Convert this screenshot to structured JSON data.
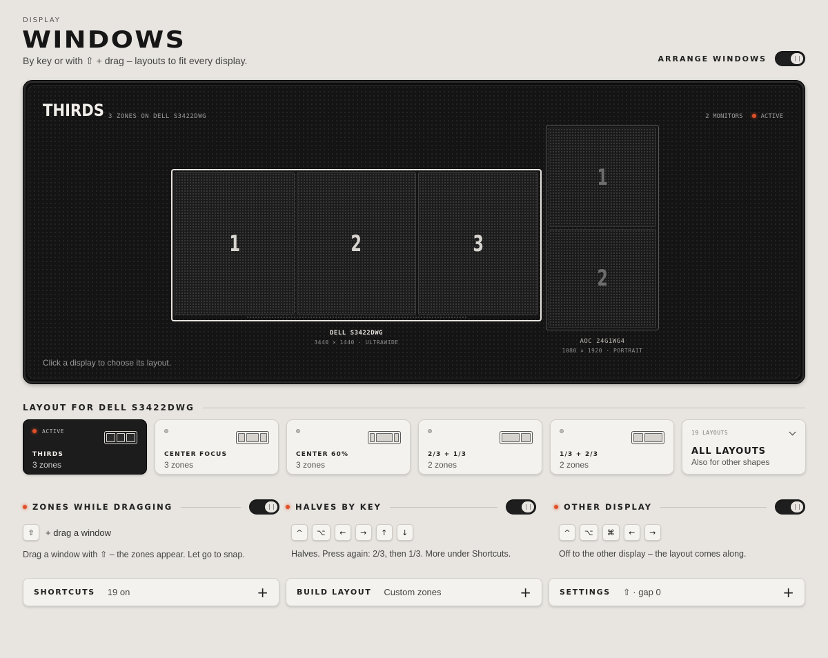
{
  "header": {
    "eyebrow": "DISPLAY",
    "title": "WINDOWS",
    "subtitle": "By key or with ⇧ + drag – layouts to fit every display.",
    "arrange_label": "ARRANGE WINDOWS",
    "arrange_on": true
  },
  "stage": {
    "title": "THIRDS",
    "subtitle": "3 ZONES ON DELL S3422DWG",
    "monitors_count": "2 MONITORS",
    "status": "ACTIVE",
    "hint": "Click a display to choose its layout.",
    "primary": {
      "name": "DELL S3422DWG",
      "spec": "3440 × 1440 · ULTRAWIDE",
      "zones": [
        "1",
        "2",
        "3"
      ]
    },
    "secondary": {
      "name": "AOC 24G1WG4",
      "spec": "1080 × 1920 · PORTRAIT",
      "zones": [
        "1",
        "2"
      ]
    }
  },
  "layouts": {
    "heading": "LAYOUT FOR DELL S3422DWG",
    "active_tag": "ACTIVE",
    "items": [
      {
        "name": "THIRDS",
        "zones": "3 zones"
      },
      {
        "name": "CENTER FOCUS",
        "zones": "3 zones"
      },
      {
        "name": "CENTER 60%",
        "zones": "3 zones"
      },
      {
        "name": "2/3 + 1/3",
        "zones": "2 zones"
      },
      {
        "name": "1/3 + 2/3",
        "zones": "2 zones"
      }
    ],
    "all": {
      "count": "19 LAYOUTS",
      "title": "ALL LAYOUTS",
      "desc": "Also for other shapes"
    }
  },
  "features": [
    {
      "title": "ZONES WHILE DRAGGING",
      "enabled": true,
      "keys": [
        "⇧"
      ],
      "keys_suffix": "+ drag a window",
      "desc": "Drag a window with ⇧ – the zones appear. Let go to snap."
    },
    {
      "title": "HALVES BY KEY",
      "enabled": true,
      "keys": [
        "^",
        "⌥",
        "←",
        "→",
        "↑",
        "↓"
      ],
      "desc": "Halves. Press again: 2/3, then 1/3. More under Shortcuts."
    },
    {
      "title": "OTHER DISPLAY",
      "enabled": true,
      "keys": [
        "^",
        "⌥",
        "⌘",
        "←",
        "→"
      ],
      "desc": "Off to the other display – the layout comes along."
    }
  ],
  "rows": [
    {
      "title": "SHORTCUTS",
      "value": "19 on"
    },
    {
      "title": "BUILD LAYOUT",
      "value": "Custom zones"
    },
    {
      "title": "SETTINGS",
      "value": "⇧ · gap 0"
    }
  ],
  "plus_glyph": "+",
  "colors": {
    "accent": "#e0512a",
    "dark": "#1c1c1c",
    "background": "#e8e5e0"
  }
}
